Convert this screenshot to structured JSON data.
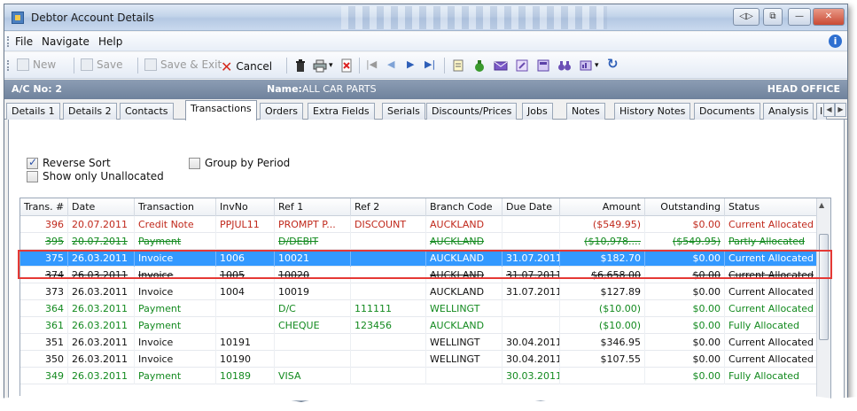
{
  "window": {
    "title": "Debtor Account Details",
    "buttons": [
      "◁▷",
      "⧉",
      "—",
      "▢",
      "✕"
    ]
  },
  "menu": [
    "File",
    "Navigate",
    "Help"
  ],
  "toolbar": {
    "new_label": "New",
    "save_label": "Save",
    "save_exit_label": "Save & Exit",
    "cancel_label": "Cancel"
  },
  "account": {
    "ac_no_label": "A/C No: 2",
    "name_label": "Name:",
    "name_value": "ALL CAR PARTS",
    "branch_label": "HEAD OFFICE"
  },
  "tabs": [
    "Details 1",
    "Details 2",
    "Contacts",
    "Transactions",
    "Orders",
    "Extra Fields",
    "Serials",
    "Discounts/Prices",
    "Jobs",
    "Notes",
    "History Notes",
    "Documents",
    "Analysis",
    "I"
  ],
  "active_tab": "Transactions",
  "options": {
    "reverse_sort": {
      "label": "Reverse Sort",
      "checked": true
    },
    "show_unallocated": {
      "label": "Show only Unallocated",
      "checked": false
    },
    "group_by_period": {
      "label": "Group by Period",
      "checked": false
    }
  },
  "grid": {
    "columns": [
      "Trans. #",
      "Date",
      "Transaction",
      "InvNo",
      "Ref 1",
      "Ref 2",
      "Branch Code",
      "Due Date",
      "Amount",
      "Outstanding",
      "Status"
    ],
    "rows": [
      {
        "trans": "396",
        "date": "20.07.2011",
        "type": "Credit Note",
        "invno": "PPJUL11",
        "ref1": "PROMPT P...",
        "ref2": "DISCOUNT",
        "branch": "AUCKLAND",
        "due": "",
        "amount": "($549.95)",
        "outstanding": "$0.00",
        "status": "Current Allocated",
        "color": "red"
      },
      {
        "trans": "395",
        "date": "20.07.2011",
        "type": "Payment",
        "invno": "",
        "ref1": "D/DEBIT",
        "ref2": "",
        "branch": "AUCKLAND",
        "due": "",
        "amount": "($10,978....",
        "outstanding": "($549.95)",
        "status": "Partly Allocated",
        "color": "green"
      },
      {
        "trans": "375",
        "date": "26.03.2011",
        "type": "Invoice",
        "invno": "1006",
        "ref1": "10021",
        "ref2": "",
        "branch": "AUCKLAND",
        "due": "31.07.2011",
        "amount": "$182.70",
        "outstanding": "$0.00",
        "status": "Current Allocated",
        "color": "black"
      },
      {
        "trans": "374",
        "date": "26.03.2011",
        "type": "Invoice",
        "invno": "1005",
        "ref1": "10020",
        "ref2": "",
        "branch": "AUCKLAND",
        "due": "31.07.2011",
        "amount": "$6,658.00",
        "outstanding": "$0.00",
        "status": "Current Allocated",
        "color": "black"
      },
      {
        "trans": "373",
        "date": "26.03.2011",
        "type": "Invoice",
        "invno": "1004",
        "ref1": "10019",
        "ref2": "",
        "branch": "AUCKLAND",
        "due": "31.07.2011",
        "amount": "$127.89",
        "outstanding": "$0.00",
        "status": "Current Allocated",
        "color": "black"
      },
      {
        "trans": "364",
        "date": "26.03.2011",
        "type": "Payment",
        "invno": "",
        "ref1": "D/C",
        "ref2": "111111",
        "branch": "WELLINGT",
        "due": "",
        "amount": "($10.00)",
        "outstanding": "$0.00",
        "status": "Current Allocated",
        "color": "green"
      },
      {
        "trans": "361",
        "date": "26.03.2011",
        "type": "Payment",
        "invno": "",
        "ref1": "CHEQUE",
        "ref2": "123456",
        "branch": "AUCKLAND",
        "due": "",
        "amount": "($10.00)",
        "outstanding": "$0.00",
        "status": "Fully Allocated",
        "color": "green"
      },
      {
        "trans": "351",
        "date": "26.03.2011",
        "type": "Invoice",
        "invno": "10191",
        "ref1": "",
        "ref2": "",
        "branch": "WELLINGT",
        "due": "30.04.2011",
        "amount": "$346.95",
        "outstanding": "$0.00",
        "status": "Current Allocated",
        "color": "black"
      },
      {
        "trans": "350",
        "date": "26.03.2011",
        "type": "Invoice",
        "invno": "10190",
        "ref1": "",
        "ref2": "",
        "branch": "WELLINGT",
        "due": "30.04.2011",
        "amount": "$107.55",
        "outstanding": "$0.00",
        "status": "Current Allocated",
        "color": "black"
      },
      {
        "trans": "349",
        "date": "26.03.2011",
        "type": "Payment",
        "invno": "10189",
        "ref1": "VISA",
        "ref2": "",
        "branch": "",
        "due": "30.03.2011",
        "amount": "",
        "outstanding": "$0.00",
        "status": "Fully Allocated",
        "color": "green"
      }
    ],
    "selected_trans": "375"
  },
  "colors": {
    "selection": "#3399ff",
    "credit_red": "#c0281b",
    "payment_green": "#138a1f",
    "callout_red": "#e53935",
    "header_bar": "#7d90aa"
  }
}
